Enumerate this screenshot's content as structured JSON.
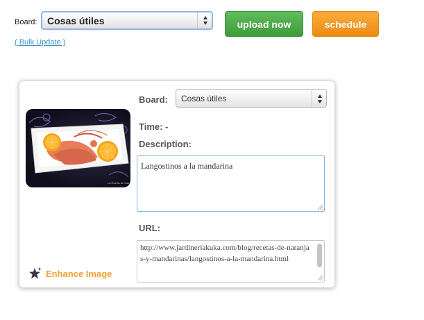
{
  "top_bar": {
    "board_label": "Board:",
    "board_selected": "Cosas útiles",
    "upload_label": "upload now",
    "schedule_label": "schedule",
    "bulk_update_label": "( Bulk Update )"
  },
  "card": {
    "board_label": "Board:",
    "board_selected": "Cosas útiles",
    "time_label": "Time: -",
    "description_label": "Description:",
    "description_value": "Langostinos a la mandarina",
    "url_label": "URL:",
    "url_value": "http://www.jardineriakuka.com/blog/recetas-de-naranjas-y-mandarinas/langostinos-a-la-mandarina.html",
    "enhance_label": "Enhance Image",
    "thumbnail_watermark": "La Huerta de Cas"
  },
  "colors": {
    "upload_green": "#4cae48",
    "schedule_orange": "#f39a1e",
    "link_blue": "#3c94c7",
    "enhance_orange": "#f0a030"
  },
  "icons": {
    "enhance": "star-sparkle-icon",
    "select_arrows": "up-down-arrows-icon"
  }
}
